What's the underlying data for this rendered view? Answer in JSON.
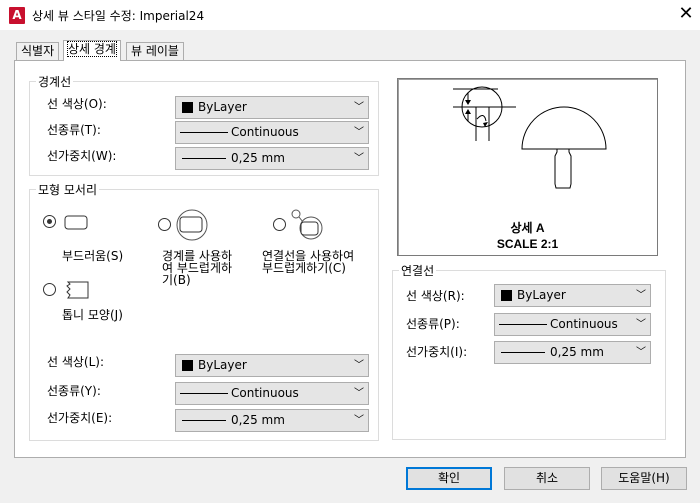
{
  "window": {
    "app_icon_letter": "A",
    "title": "상세 뷰 스타일 수정: Imperial24",
    "close_symbol": "✕"
  },
  "tabs": [
    {
      "label": "식별자",
      "active": false
    },
    {
      "label": "상세 경계",
      "active": true
    },
    {
      "label": "뷰 레이블",
      "active": false
    }
  ],
  "boundary": {
    "group_title": "경계선",
    "color_label": "선 색상(O):",
    "color_value": "ByLayer",
    "linetype_label": "선종류(T):",
    "linetype_value": "Continuous",
    "lineweight_label": "선가중치(W):",
    "lineweight_value": "0,25 mm"
  },
  "model_edge": {
    "group_title": "모형 모서리",
    "option_smooth": "부드러움(S)",
    "option_smooth_border_line1": "경계를 사용하",
    "option_smooth_border_line2": "여 부드럽게하",
    "option_smooth_border_line3": "기(B)",
    "option_smooth_connection_line1": "연결선을 사용하여",
    "option_smooth_connection_line2": "부드럽게하기(C)",
    "option_jagged": "톱니 모양(J)",
    "selected_option": "부드러움(S)",
    "color_label": "선 색상(L):",
    "color_value": "ByLayer",
    "linetype_label": "선종류(Y):",
    "linetype_value": "Continuous",
    "lineweight_label": "선가중치(E):",
    "lineweight_value": "0,25 mm"
  },
  "preview": {
    "caption_line1": "상세 A",
    "caption_line2": "SCALE 2:1"
  },
  "connection": {
    "group_title": "연결선",
    "color_label": "선 색상(R):",
    "color_value": "ByLayer",
    "linetype_label": "선종류(P):",
    "linetype_value": "Continuous",
    "lineweight_label": "선가중치(I):",
    "lineweight_value": "0,25 mm"
  },
  "buttons": {
    "ok": "확인",
    "cancel": "취소",
    "help": "도움말(H)"
  },
  "colors": {
    "accent_focus": "#0078d7",
    "app_icon": "#c8102e"
  }
}
